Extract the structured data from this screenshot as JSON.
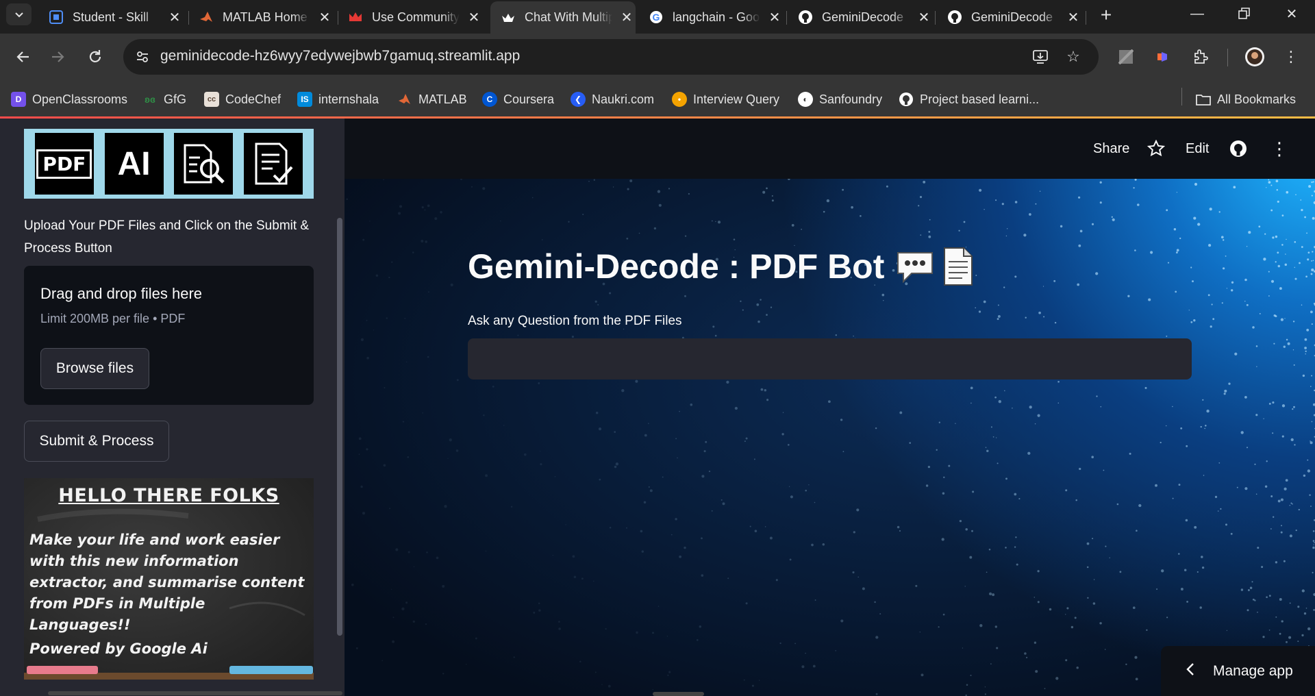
{
  "browser": {
    "tabs": [
      {
        "title": "Student - Skill",
        "favicon": "skillup-icon",
        "active": false
      },
      {
        "title": "MATLAB Home",
        "favicon": "matlab-icon",
        "active": false
      },
      {
        "title": "Use Community",
        "favicon": "crown-icon",
        "active": false
      },
      {
        "title": "Chat With Multiple",
        "favicon": "streamlit-icon",
        "active": true
      },
      {
        "title": "langchain - Google",
        "favicon": "google-icon",
        "active": false
      },
      {
        "title": "GeminiDecode",
        "favicon": "github-icon",
        "active": false
      },
      {
        "title": "GeminiDecode",
        "favicon": "github-icon",
        "active": false
      }
    ],
    "url": "geminidecode-hz6wyy7edywejbwb7gamuq.streamlit.app",
    "bookmarks": [
      {
        "label": "OpenClassrooms",
        "icon": "openclassrooms-icon",
        "color": "#7451eb"
      },
      {
        "label": "GfG",
        "icon": "gfg-icon",
        "color": "#2f8d46"
      },
      {
        "label": "CodeChef",
        "icon": "codechef-icon",
        "color": "#5b4638"
      },
      {
        "label": "internshala",
        "icon": "internshala-icon",
        "color": "#008bdc"
      },
      {
        "label": "MATLAB",
        "icon": "matlab-icon",
        "color": "#e16737"
      },
      {
        "label": "Coursera",
        "icon": "coursera-icon",
        "color": "#0056d2"
      },
      {
        "label": "Naukri.com",
        "icon": "naukri-icon",
        "color": "#275df5"
      },
      {
        "label": "Interview Query",
        "icon": "interview-query-icon",
        "color": "#f4a300"
      },
      {
        "label": "Sanfoundry",
        "icon": "sanfoundry-icon",
        "color": "#ffffff"
      },
      {
        "label": "Project based learni...",
        "icon": "github-icon",
        "color": "#ffffff"
      }
    ],
    "all_bookmarks": "All Bookmarks"
  },
  "sidebar": {
    "banner_pdf": "PDF",
    "banner_ai": "AI",
    "instructions": "Upload Your PDF Files and Click on the Submit & Process Button",
    "dropzone": {
      "title": "Drag and drop files here",
      "limit": "Limit 200MB per file • PDF",
      "browse_label": "Browse files"
    },
    "submit_label": "Submit & Process",
    "chalkboard": {
      "heading": "HELLO THERE FOLKS",
      "body": "Make your life and work easier with this new information extractor, and summarise content from PDFs in Multiple Languages!!",
      "footer": "Powered by Google Ai"
    }
  },
  "header": {
    "share": "Share",
    "edit": "Edit"
  },
  "main": {
    "title": "Gemini-Decode : PDF Bot",
    "question_label": "Ask any Question from the PDF Files",
    "question_value": "",
    "manage_app": "Manage app"
  },
  "colors": {
    "accent": "#ff4b4b",
    "sidebar_bg": "#262730",
    "app_bg": "#0e1117"
  }
}
